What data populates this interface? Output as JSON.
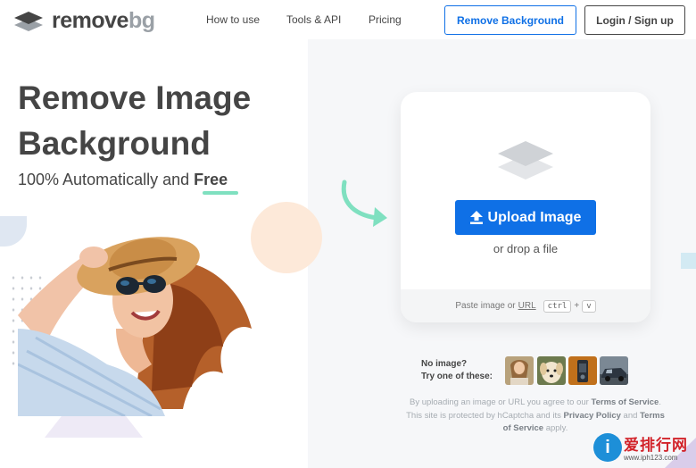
{
  "header": {
    "logo_word1": "remove",
    "logo_word2": "bg",
    "nav": [
      "How to use",
      "Tools & API",
      "Pricing"
    ],
    "remove_bg_button": "Remove Background",
    "login_button": "Login / Sign up"
  },
  "hero": {
    "title_line1": "Remove Image",
    "title_line2": "Background",
    "subtitle_prefix": "100% Automatically and ",
    "subtitle_emphasis": "Free"
  },
  "upload": {
    "button_label": "Upload Image",
    "drop_text": "or drop a file",
    "paste_prefix": "Paste image or",
    "paste_url": "URL",
    "key1": "ctrl",
    "plus": "+",
    "key2": "v"
  },
  "samples": {
    "line1": "No image?",
    "line2": "Try one of these:",
    "thumbnails": [
      "woman-thumbnail",
      "dog-thumbnail",
      "product-thumbnail",
      "car-thumbnail"
    ]
  },
  "legal": {
    "t1": "By uploading an image or URL you agree to our ",
    "l1": "Terms of Service",
    "t2": ". This site is protected by hCaptcha and its ",
    "l2": "Privacy Policy",
    "t3": " and ",
    "l3": "Terms of Service",
    "t4": " apply."
  },
  "watermark": {
    "glyph": "i",
    "cn_text": "爱排行网",
    "url": "www.iph123.com"
  },
  "colors": {
    "accent": "#0f70e6",
    "text": "#454545",
    "underline": "#7fe0c0",
    "arrow": "#7fe0c0"
  }
}
